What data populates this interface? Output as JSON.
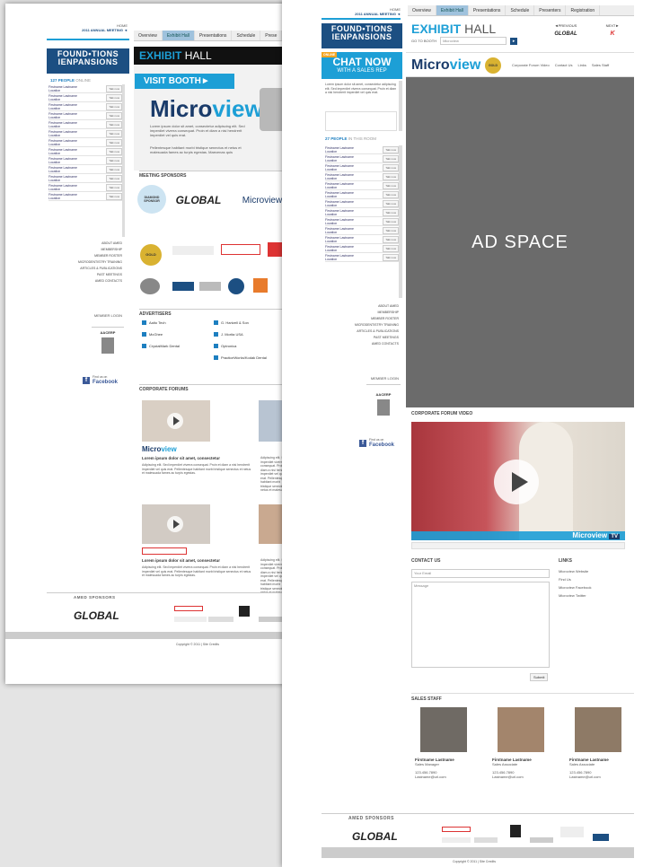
{
  "pageA": {
    "top_links": {
      "home": "HOME",
      "meeting": "2011 ANNUAL MEETING ◄"
    },
    "tabs": [
      "Overview",
      "Exhibit Hall",
      "Presentations",
      "Schedule",
      "Prese"
    ],
    "logo_line1": "FOUND•TIONS",
    "logo_line2": "IENPANSIONS",
    "exhibit_title": "EXHIBIT",
    "exhibit_title2": "HALL",
    "visit_booth": "VISIT BOOTH►",
    "people_online": "127 PEOPLE",
    "people_online_suffix": "ONLINE",
    "brand": "Micro",
    "brand_v": "view",
    "promo_text": "Lorem ipsum dolor sit amet, consectetur adipiscing elit. Sed imperdiet viverra consequat. Proin et diam a nisi hendrerit imperdiet vel quis erat.",
    "promo_text2": "Pellentesque habitant morbi tristique senectus et netus et malesuada fames ac turpis egestas. Maecenas quis",
    "meeting_sponsors": "MEETING SPONSORS",
    "sponsor_diamond": "DIAMOND SPONSOR",
    "sponsor_global": "GLOBAL",
    "sponsor_micro": "Microview",
    "sponsor_gold": "GOLD",
    "list_name": "Firstname Lastname",
    "list_loc": "Location",
    "list_btn": "Talk now",
    "nav_links": [
      "ABOUT AMED",
      "MEMBERSHIP",
      "MEMBER ROSTER",
      "MICRODENTISTRY TRAINING",
      "ARTICLES & PUBLICATIONS",
      "PAST MEETINGS",
      "AMED CONTACTS"
    ],
    "member_login": "MEMBER LOGIN",
    "advertisers": "ADVERTISERS",
    "adv_items": [
      "Aalto Tech",
      "G. Hartzell & Son",
      "McGhee",
      "J. Morita USA",
      "CrystalMark Dental",
      "Optronica",
      "",
      "PracticeWorks/Kodak Dental"
    ],
    "corporate_forums": "CORPORATE FORUMS",
    "forum_title": "Lorem ipsum dolor sit amet, consectetur",
    "forum_text": "Adipiscing elit. Sed imperdiet viverra consequat. Proin et diam a nisi hendrerit imperdiet vel quis erat. Pellentesque habitant morbi tristique senectus et netus et malesuada fames ac turpis egestas.",
    "find_us": "Find us on",
    "facebook": "Facebook",
    "amed_sponsors": "AMED SPONSORS",
    "footer_global": "GLOBAL",
    "copyright": "Copyright © 2011  |  Site Credits"
  },
  "pageB": {
    "top_links": {
      "home": "HOME",
      "meeting": "2011 ANNUAL MEETING ◄"
    },
    "tabs": [
      "Overview",
      "Exhibit Hall",
      "Presentations",
      "Schedule",
      "Presenters",
      "Registration"
    ],
    "logo_line1": "FOUND•TIONS",
    "logo_line2": "IENPANSIONS",
    "exhibit_title": "EXHIBIT",
    "exhibit_title2": "HALL",
    "go_to_booth": "GO TO BOOTH",
    "booth_value": "Microview",
    "previous": "◄PREVIOUS",
    "next": "NEXT►",
    "prev_logo": "GLOBAL",
    "next_logo": "K",
    "online_badge": "ONLINE",
    "chat_now": "CHAT NOW",
    "with_rep": "WITH A SALES REP",
    "brand": "Micro",
    "brand_v": "view",
    "gold": "GOLD",
    "booth_links": [
      "Corporate Forum Video",
      "Contact Us",
      "Links",
      "Sales Staff"
    ],
    "chat_text": "Lorem ipsum dolor sit amet, consectetur adipiscing elit. Sed imperdiet viverra consequat. Proin et diam a nisi hendrerit imperdiet vel quis erat.",
    "people_in_room": "27 PEOPLE",
    "people_suffix": "IN THIS ROOM",
    "list_name": "Firstname Lastname",
    "list_loc": "Location",
    "list_btn": "Talk now",
    "nav_links": [
      "ABOUT AMED",
      "MEMBERSHIP",
      "MEMBER ROSTER",
      "MICRODENTISTRY TRAINING",
      "ARTICLES & PUBLICATIONS",
      "PAST MEETINGS",
      "AMED CONTACTS"
    ],
    "member_login": "MEMBER LOGIN",
    "ad_space": "AD SPACE",
    "corporate_video": "CORPORATE FORUM VIDEO",
    "video_brand": "Microview",
    "video_tv": "TV",
    "contact_us": "CONTACT US",
    "your_email": "Your Email",
    "message": "Message",
    "submit": "Submit",
    "links": "LINKS",
    "links_items": [
      "Microview Website",
      "Find Us",
      "Microview Facebook",
      "Microview Twitter"
    ],
    "sales_staff": "SALES STAFF",
    "staff": [
      {
        "name": "Firstname Lastname",
        "role": "Sales Manager",
        "phone": "123.456.7890",
        "email": "Lastname@url.com"
      },
      {
        "name": "Firstname Lastname",
        "role": "Sales Associate",
        "phone": "123.456.7890",
        "email": "Lastname@url.com"
      },
      {
        "name": "Firstname Lastname",
        "role": "Sales Associate",
        "phone": "123.456.7890",
        "email": "Lastname@url.com"
      }
    ],
    "find_us": "Find us on",
    "facebook": "Facebook",
    "amed_sponsors": "AMED SPONSORS",
    "footer_global": "GLOBAL",
    "copyright": "Copyright © 2011  |  Site Credits"
  },
  "colors": {
    "accent": "#1d9fd6",
    "navy": "#1c4f82",
    "ad_gray": "#6b6b6b",
    "facebook": "#3b5998"
  }
}
